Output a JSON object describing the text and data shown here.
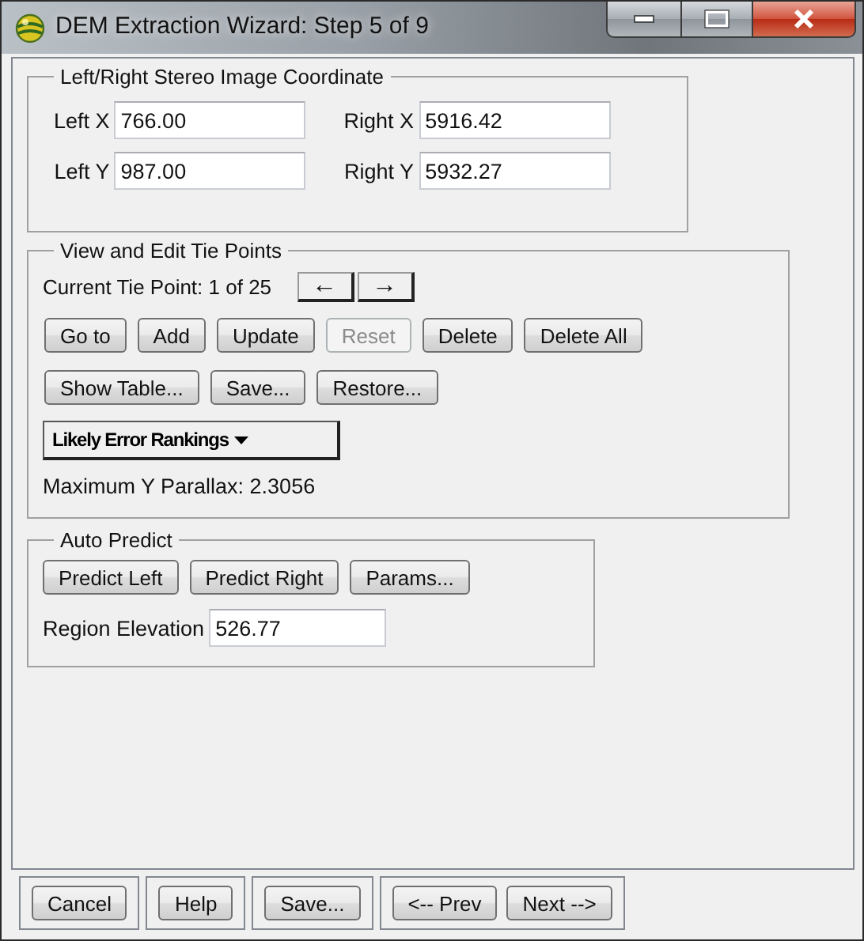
{
  "window": {
    "title": "DEM Extraction Wizard: Step 5 of 9"
  },
  "coordinates": {
    "title": "Left/Right Stereo Image Coordinate",
    "fields": [
      {
        "label": "Left X",
        "value": "766.00"
      },
      {
        "label": "Right X",
        "value": "5916.42"
      },
      {
        "label": "Left Y",
        "value": "987.00"
      },
      {
        "label": "Right Y",
        "value": "5932.27"
      }
    ]
  },
  "tie_points": {
    "title": "View and Edit Tie Points",
    "current": "Current Tie Point: 1 of 25",
    "nav_buttons": [
      "←",
      "→"
    ],
    "button_rows": [
      [
        {
          "label": "Go to",
          "disabled": false
        },
        {
          "label": "Add",
          "disabled": false
        },
        {
          "label": "Update",
          "disabled": false
        },
        {
          "label": "Reset",
          "disabled": true
        },
        {
          "label": "Delete",
          "disabled": false
        },
        {
          "label": "Delete All",
          "disabled": false
        }
      ],
      [
        {
          "label": "Show Table...",
          "disabled": false
        },
        {
          "label": "Save...",
          "disabled": false
        },
        {
          "label": "Restore...",
          "disabled": false
        }
      ]
    ],
    "rankings_menu": {
      "label": "Likely Error Rankings"
    },
    "parallax": "Maximum Y Parallax: 2.3056"
  },
  "auto_predict": {
    "title": "Auto Predict",
    "buttons": [
      {
        "label": "Predict Left",
        "disabled": false
      },
      {
        "label": "Predict Right",
        "disabled": false
      },
      {
        "label": "Params...",
        "disabled": false
      }
    ],
    "elevation": {
      "label": "Region Elevation",
      "value": "526.77"
    }
  },
  "footer": {
    "button_groups": [
      [
        "Cancel"
      ],
      [
        "Help"
      ],
      [
        "Save..."
      ],
      [
        "<-- Prev",
        "Next -->"
      ]
    ]
  }
}
